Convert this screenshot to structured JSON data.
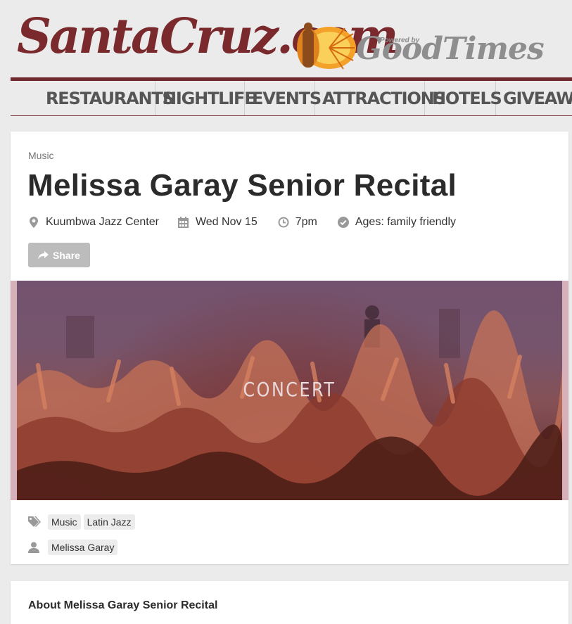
{
  "logo": {
    "main": "SantaCruz.com",
    "powered_by": "Powered by",
    "partner": "GoodTimes"
  },
  "nav": {
    "items": [
      "RESTAURANTS",
      "NIGHTLIFE",
      "EVENTS",
      "ATTRACTIONS",
      "HOTELS",
      "GIVEAWAYS"
    ]
  },
  "event": {
    "category": "Music",
    "title": "Melissa Garay Senior Recital",
    "venue": "Kuumbwa Jazz Center",
    "date": "Wed Nov 15",
    "time": "7pm",
    "ages": "Ages: family friendly",
    "share_label": "Share",
    "hero_text": "CONCERT",
    "tags": [
      "Music",
      "Latin Jazz"
    ],
    "performers": [
      "Melissa Garay"
    ]
  },
  "about": {
    "heading": "About Melissa Garay Senior Recital"
  },
  "colors": {
    "brand": "#7a2a2d",
    "nav_text": "#555555",
    "share_button": "#bcbcbc",
    "hero_border": "#d6b1b9"
  },
  "icons": {
    "venue": "map-pin-icon",
    "date": "calendar-icon",
    "time": "clock-icon",
    "ages": "check-circle-icon",
    "share": "share-arrow-icon",
    "tags": "tags-icon",
    "performer": "user-icon"
  }
}
